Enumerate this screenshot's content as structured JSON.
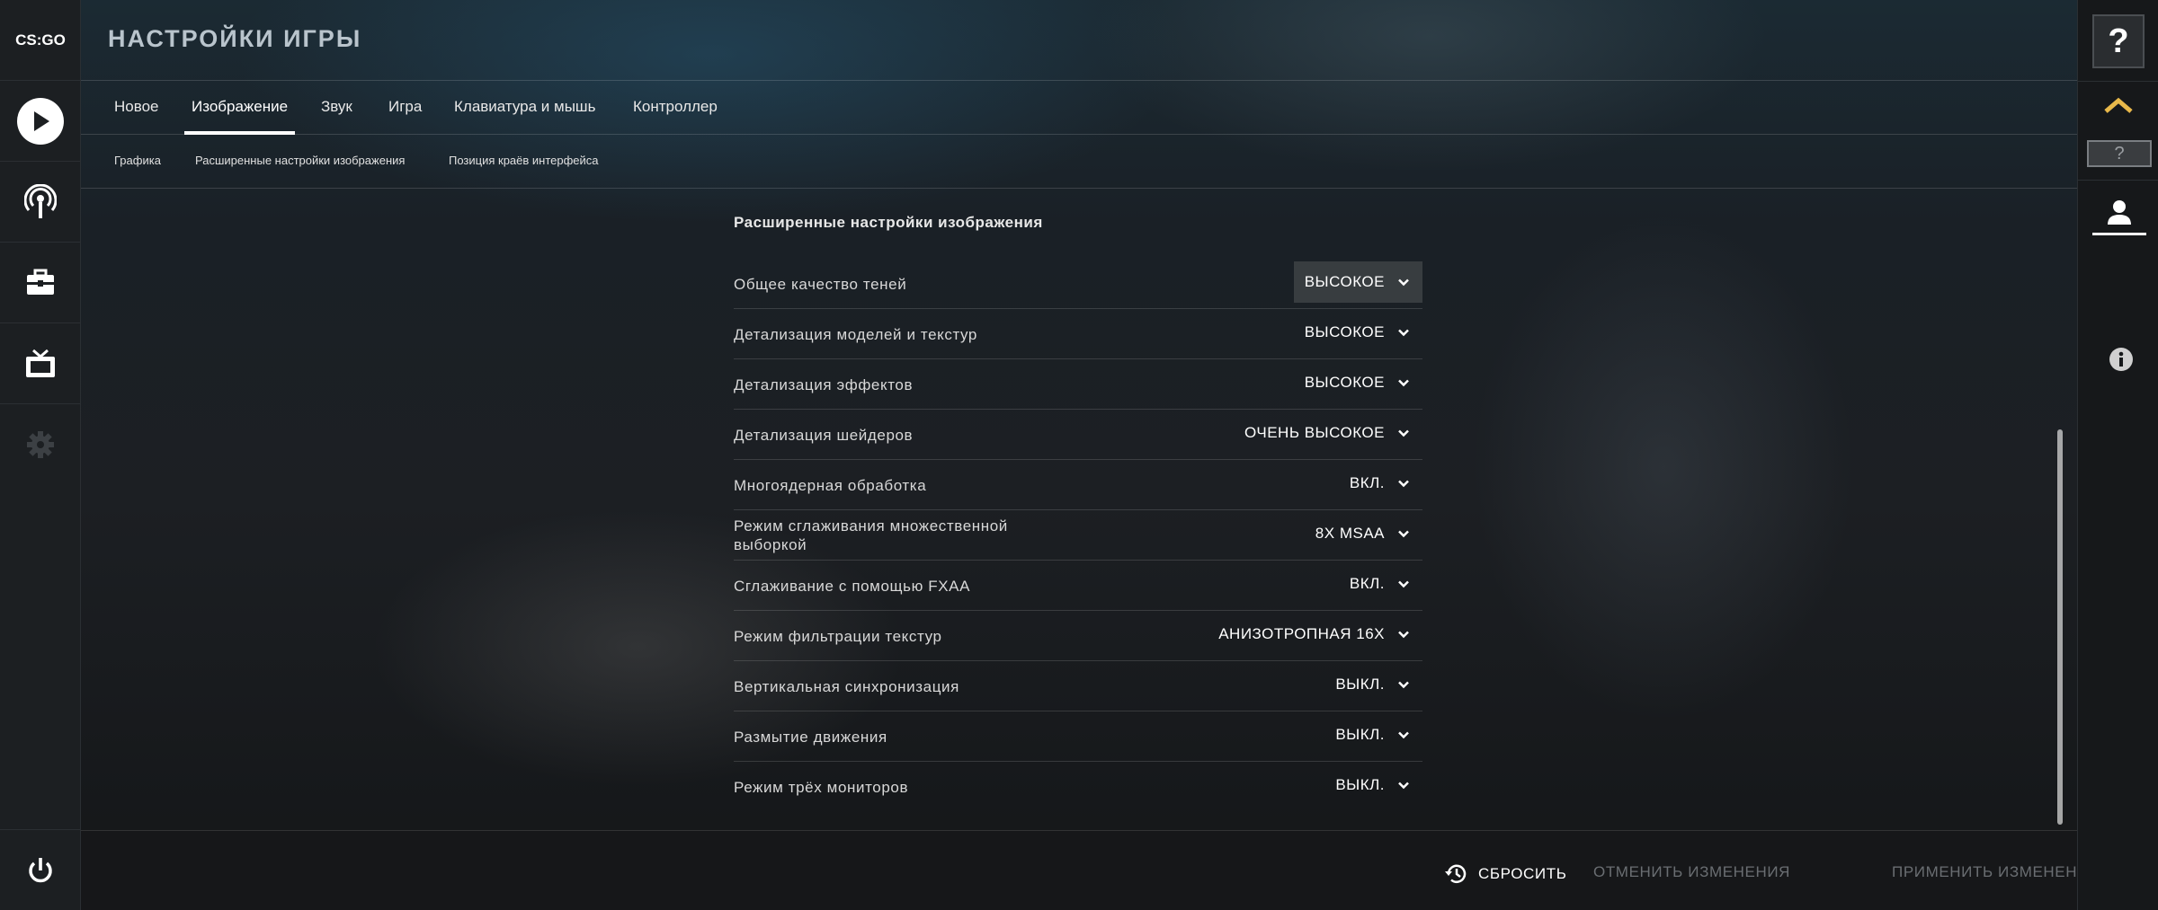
{
  "app": {
    "logo_text": "CS:GO",
    "title": "НАСТРОЙКИ ИГРЫ"
  },
  "left_sidebar": {
    "items": [
      {
        "icon": "play-icon",
        "name": "play"
      },
      {
        "icon": "broadcast-icon",
        "name": "watch"
      },
      {
        "icon": "inventory-icon",
        "name": "inventory"
      },
      {
        "icon": "tv-icon",
        "name": "tv"
      },
      {
        "icon": "gear-icon",
        "name": "settings"
      },
      {
        "icon": "power-icon",
        "name": "quit"
      }
    ]
  },
  "tabs": [
    {
      "label": "Новое",
      "active": false
    },
    {
      "label": "Изображение",
      "active": true
    },
    {
      "label": "Звук",
      "active": false
    },
    {
      "label": "Игра",
      "active": false
    },
    {
      "label": "Клавиатура и мышь",
      "active": false
    },
    {
      "label": "Контроллер",
      "active": false
    }
  ],
  "subtabs": [
    {
      "label": "Графика"
    },
    {
      "label": "Расширенные настройки изображения"
    },
    {
      "label": "Позиция краёв интерфейса"
    }
  ],
  "section": {
    "heading": "Расширенные настройки изображения"
  },
  "settings": [
    {
      "label": "Общее качество теней",
      "value": "ВЫСОКОЕ"
    },
    {
      "label": "Детализация моделей и текстур",
      "value": "ВЫСОКОЕ"
    },
    {
      "label": "Детализация эффектов",
      "value": "ВЫСОКОЕ"
    },
    {
      "label": "Детализация шейдеров",
      "value": "ОЧЕНЬ ВЫСОКОЕ"
    },
    {
      "label": "Многоядерная обработка",
      "value": "ВКЛ."
    },
    {
      "label": "Режим сглаживания множественной выборкой",
      "value": "8X MSAA"
    },
    {
      "label": "Сглаживание с помощью FXAA",
      "value": "ВКЛ."
    },
    {
      "label": "Режим фильтрации текстур",
      "value": "АНИЗОТРОПНАЯ 16X"
    },
    {
      "label": "Вертикальная синхронизация",
      "value": "ВЫКЛ."
    },
    {
      "label": "Размытие движения",
      "value": "ВЫКЛ."
    },
    {
      "label": "Режим трёх мониторов",
      "value": "ВЫКЛ."
    }
  ],
  "bottom_bar": {
    "reset_label": "СБРОСИТЬ",
    "cancel_label": "ОТМЕНИТЬ ИЗМЕНЕНИЯ",
    "apply_label": "ПРИМЕНИТЬ ИЗМЕНЕНИЯ"
  },
  "right_sidebar": {
    "help_label": "?",
    "rank_label": "?"
  },
  "colors": {
    "text": "#e6e6e6",
    "disabled": "#6a6e72",
    "rank_chevron": "#e8b84a"
  }
}
